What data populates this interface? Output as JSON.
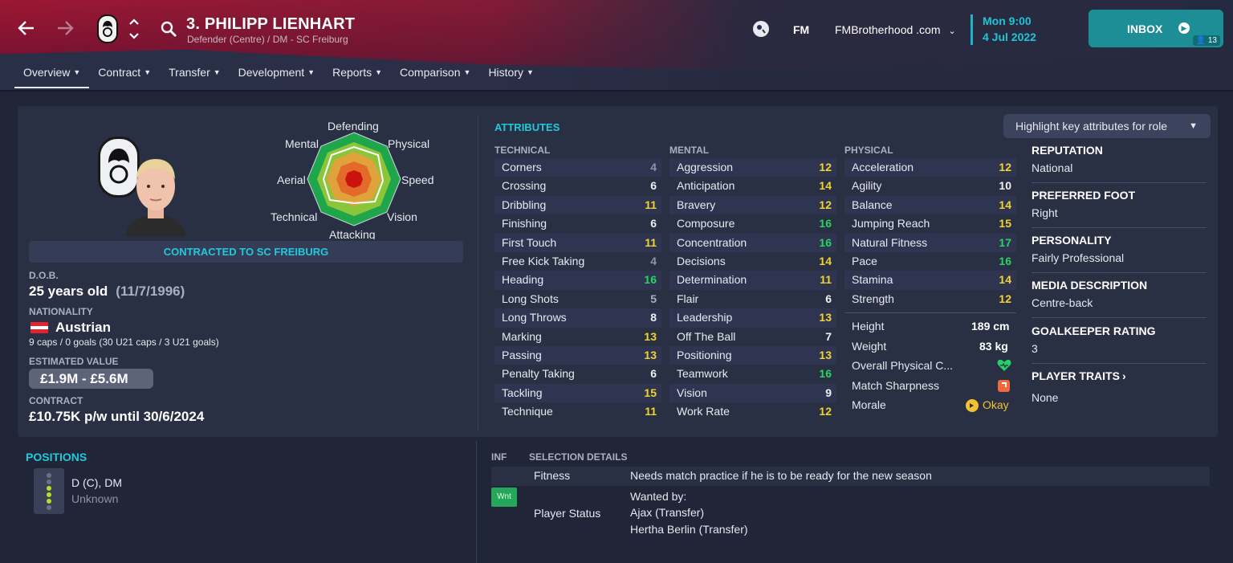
{
  "header": {
    "title": "3. PHILIPP LIENHART",
    "subtitle": "Defender (Centre) / DM - SC Freiburg",
    "fm_label": "FM",
    "account": "FMBrotherhood .com",
    "date_line1": "Mon 9:00",
    "date_line2": "4 Jul 2022",
    "inbox_label": "INBOX",
    "inbox_count": "13",
    "tabs": [
      {
        "label": "Overview",
        "active": true
      },
      {
        "label": "Contract"
      },
      {
        "label": "Transfer"
      },
      {
        "label": "Development"
      },
      {
        "label": "Reports"
      },
      {
        "label": "Comparison"
      },
      {
        "label": "History"
      }
    ],
    "colors": {
      "header_red": "#9c1733",
      "accent": "#22c9dc",
      "inbox": "#1d8d96"
    }
  },
  "radar": {
    "labels": [
      "Defending",
      "Physical",
      "Speed",
      "Vision",
      "Attacking",
      "Technical",
      "Aerial",
      "Mental"
    ]
  },
  "profile": {
    "contracted_to": "CONTRACTED TO SC FREIBURG",
    "dob_label": "D.O.B.",
    "age": "25 years old",
    "dob": "(11/7/1996)",
    "nationality_label": "NATIONALITY",
    "nationality": "Austrian",
    "caps": "9 caps / 0 goals (30 U21 caps / 3 U21 goals)",
    "value_label": "ESTIMATED VALUE",
    "value": "£1.9M - £5.6M",
    "contract_label": "CONTRACT",
    "contract": "£10.75K p/w until 30/6/2024"
  },
  "attributes": {
    "title": "ATTRIBUTES",
    "highlight_label": "Highlight key attributes for role",
    "technical_label": "TECHNICAL",
    "mental_label": "MENTAL",
    "physical_label": "PHYSICAL",
    "technical": [
      {
        "name": "Corners",
        "value": "4"
      },
      {
        "name": "Crossing",
        "value": "6"
      },
      {
        "name": "Dribbling",
        "value": "11"
      },
      {
        "name": "Finishing",
        "value": "6"
      },
      {
        "name": "First Touch",
        "value": "11"
      },
      {
        "name": "Free Kick Taking",
        "value": "4"
      },
      {
        "name": "Heading",
        "value": "16"
      },
      {
        "name": "Long Shots",
        "value": "5"
      },
      {
        "name": "Long Throws",
        "value": "8"
      },
      {
        "name": "Marking",
        "value": "13"
      },
      {
        "name": "Passing",
        "value": "13"
      },
      {
        "name": "Penalty Taking",
        "value": "6"
      },
      {
        "name": "Tackling",
        "value": "15"
      },
      {
        "name": "Technique",
        "value": "11"
      }
    ],
    "mental": [
      {
        "name": "Aggression",
        "value": "12"
      },
      {
        "name": "Anticipation",
        "value": "14"
      },
      {
        "name": "Bravery",
        "value": "12"
      },
      {
        "name": "Composure",
        "value": "16"
      },
      {
        "name": "Concentration",
        "value": "16"
      },
      {
        "name": "Decisions",
        "value": "14"
      },
      {
        "name": "Determination",
        "value": "11"
      },
      {
        "name": "Flair",
        "value": "6"
      },
      {
        "name": "Leadership",
        "value": "13"
      },
      {
        "name": "Off The Ball",
        "value": "7"
      },
      {
        "name": "Positioning",
        "value": "13"
      },
      {
        "name": "Teamwork",
        "value": "16"
      },
      {
        "name": "Vision",
        "value": "9"
      },
      {
        "name": "Work Rate",
        "value": "12"
      }
    ],
    "physical": [
      {
        "name": "Acceleration",
        "value": "12"
      },
      {
        "name": "Agility",
        "value": "10"
      },
      {
        "name": "Balance",
        "value": "14"
      },
      {
        "name": "Jumping Reach",
        "value": "15"
      },
      {
        "name": "Natural Fitness",
        "value": "17"
      },
      {
        "name": "Pace",
        "value": "16"
      },
      {
        "name": "Stamina",
        "value": "14"
      },
      {
        "name": "Strength",
        "value": "12"
      }
    ],
    "height_label": "Height",
    "height": "189 cm",
    "weight_label": "Weight",
    "weight": "83 kg",
    "overall_label": "Overall Physical C...",
    "sharpness_label": "Match Sharpness",
    "morale_label": "Morale",
    "morale": "Okay"
  },
  "info": {
    "reputation_label": "REPUTATION",
    "reputation": "National",
    "foot_label": "PREFERRED FOOT",
    "foot": "Right",
    "personality_label": "PERSONALITY",
    "personality": "Fairly Professional",
    "media_label": "MEDIA DESCRIPTION",
    "media": "Centre-back",
    "gk_label": "GOALKEEPER RATING",
    "gk": "3",
    "traits_label": "PLAYER TRAITS",
    "traits": "None"
  },
  "positions": {
    "title": "POSITIONS",
    "primary": "D (C), DM",
    "secondary": "Unknown"
  },
  "selection": {
    "inf_label": "INF",
    "title": "SELECTION DETAILS",
    "fitness_label": "Fitness",
    "fitness": "Needs match practice if he is to be ready for the new season",
    "badge": "Wnt",
    "status_label": "Player Status",
    "wanted_by": "Wanted by:",
    "club1": "Ajax (Transfer)",
    "club2": "Hertha Berlin (Transfer)"
  }
}
